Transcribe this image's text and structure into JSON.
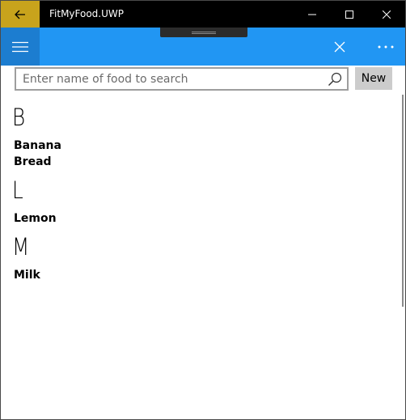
{
  "titlebar": {
    "title": "FitMyFood.UWP",
    "back_icon": "arrow-left-icon",
    "minimize_icon": "minimize-icon",
    "maximize_icon": "maximize-icon",
    "close_icon": "close-icon",
    "accent_color": "#c8a31c"
  },
  "appbar": {
    "menu_icon": "hamburger-icon",
    "close_icon": "close-icon",
    "more_icon": "more-icon",
    "background_color": "#2196f3"
  },
  "search": {
    "placeholder": "Enter name of food to search",
    "value": "",
    "icon": "search-icon"
  },
  "new_button": {
    "label": "New"
  },
  "groups": [
    {
      "letter": "B",
      "items": [
        "Banana",
        "Bread"
      ]
    },
    {
      "letter": "L",
      "items": [
        "Lemon"
      ]
    },
    {
      "letter": "M",
      "items": [
        "Milk"
      ]
    }
  ]
}
